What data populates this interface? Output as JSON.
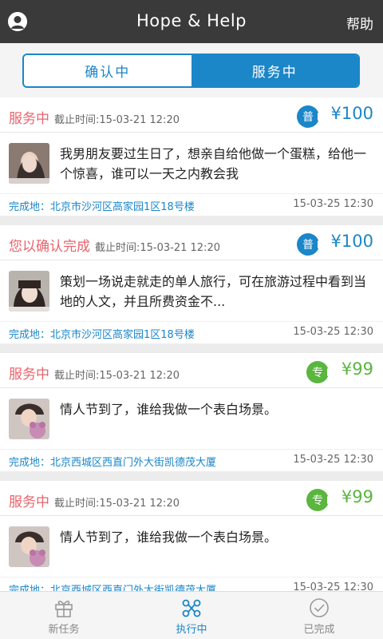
{
  "header": {
    "title": "Hope & Help",
    "help_label": "帮助"
  },
  "segment": {
    "left_label": "确认中",
    "right_label": "服务中",
    "active": "right"
  },
  "colors": {
    "header_bg": "#3a3a3a",
    "accent_blue": "#1b86c8",
    "status_red": "#e8636b",
    "badge_green": "#5ab63e"
  },
  "cards": [
    {
      "status": "服务中",
      "deadline": "截止时间:15-03-21 12:20",
      "badge": "普",
      "badge_color": "blue",
      "price": "¥100",
      "description": "我男朋友要过生日了，想亲自给他做一个蛋糕，给他一个惊喜，谁可以一天之内教会我",
      "location": "完成地：北京市沙河区高家园1区18号楼",
      "date": "15-03-25 12:30"
    },
    {
      "status": "您以确认完成",
      "deadline": "截止时间:15-03-21 12:20",
      "badge": "普",
      "badge_color": "blue",
      "price": "¥100",
      "description": "策划一场说走就走的单人旅行，可在旅游过程中看到当地的人文，并且所费资金不...",
      "location": "完成地：北京市沙河区高家园1区18号楼",
      "date": "15-03-25 12:30"
    },
    {
      "status": "服务中",
      "deadline": "截止时间:15-03-21 12:20",
      "badge": "专",
      "badge_color": "green",
      "price": "¥99",
      "description": "情人节到了，谁给我做一个表白场景。",
      "location": "完成地：北京西城区西直门外大街凯德茂大厦",
      "date": "15-03-25 12:30"
    },
    {
      "status": "服务中",
      "deadline": "截止时间:15-03-21 12:20",
      "badge": "专",
      "badge_color": "green",
      "price": "¥99",
      "description": "情人节到了，谁给我做一个表白场景。",
      "location": "完成地：北京西城区西直门外大街凯德茂大厦",
      "date": "15-03-25 12:30"
    }
  ],
  "tabbar": [
    {
      "label": "新任务",
      "icon": "gift-icon",
      "active": false
    },
    {
      "label": "执行中",
      "icon": "nodes-icon",
      "active": true
    },
    {
      "label": "已完成",
      "icon": "check-circle-icon",
      "active": false
    }
  ]
}
